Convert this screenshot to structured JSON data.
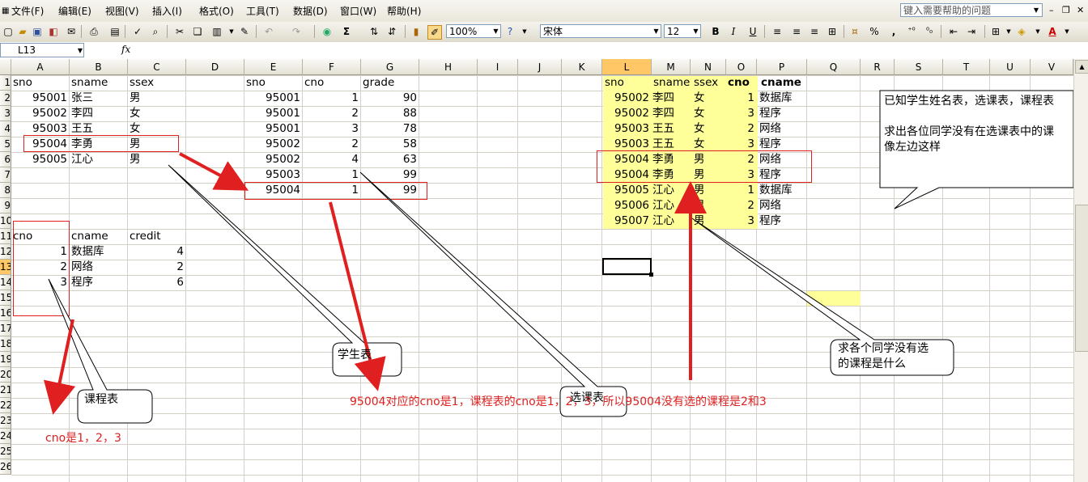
{
  "menu": [
    "文件(F)",
    "编辑(E)",
    "视图(V)",
    "插入(I)",
    "格式(O)",
    "工具(T)",
    "数据(D)",
    "窗口(W)",
    "帮助(H)"
  ],
  "help_placeholder": "键入需要帮助的问题",
  "toolbar": {
    "zoom": "100%",
    "font": "宋体",
    "size": "12",
    "bold": "B",
    "italic": "I",
    "underline": "U",
    "sigma": "Σ",
    "percent": "%",
    "comma": ","
  },
  "namebox": "L13",
  "fx": "fx",
  "columns": [
    "A",
    "B",
    "C",
    "D",
    "E",
    "F",
    "G",
    "H",
    "I",
    "J",
    "K",
    "L",
    "M",
    "N",
    "O",
    "P",
    "Q",
    "R",
    "S",
    "T",
    "U",
    "V"
  ],
  "rows": [
    "1",
    "2",
    "3",
    "4",
    "5",
    "6",
    "7",
    "8",
    "9",
    "10",
    "11",
    "12",
    "13",
    "14",
    "15",
    "16",
    "17",
    "18",
    "19",
    "20",
    "21",
    "22",
    "23",
    "24",
    "25",
    "26"
  ],
  "active_cell": {
    "column": "L",
    "row": "13"
  },
  "student_table": {
    "headers": [
      "sno",
      "sname",
      "ssex"
    ],
    "rows": [
      [
        "95001",
        "张三",
        "男"
      ],
      [
        "95002",
        "李四",
        "女"
      ],
      [
        "95003",
        "王五",
        "女"
      ],
      [
        "95004",
        "李勇",
        "男"
      ],
      [
        "95005",
        "江心",
        "男"
      ]
    ]
  },
  "sc_table": {
    "headers": [
      "sno",
      "cno",
      "grade"
    ],
    "rows": [
      [
        "95001",
        "1",
        "90"
      ],
      [
        "95001",
        "2",
        "88"
      ],
      [
        "95001",
        "3",
        "78"
      ],
      [
        "95002",
        "2",
        "58"
      ],
      [
        "95002",
        "4",
        "63"
      ],
      [
        "95003",
        "1",
        "99"
      ],
      [
        "95004",
        "1",
        "99"
      ]
    ]
  },
  "course_table": {
    "headers": [
      "cno",
      "cname",
      "credit"
    ],
    "rows": [
      [
        "1",
        "数据库",
        "4"
      ],
      [
        "2",
        "网络",
        "2"
      ],
      [
        "3",
        "程序",
        "6"
      ]
    ]
  },
  "result_table": {
    "headers": [
      "sno",
      "sname",
      "ssex",
      "cno",
      "cname"
    ],
    "rows": [
      [
        "95002",
        "李四",
        "女",
        "1",
        "数据库"
      ],
      [
        "95002",
        "李四",
        "女",
        "3",
        "程序"
      ],
      [
        "95003",
        "王五",
        "女",
        "2",
        "网络"
      ],
      [
        "95003",
        "王五",
        "女",
        "3",
        "程序"
      ],
      [
        "95004",
        "李勇",
        "男",
        "2",
        "网络"
      ],
      [
        "95004",
        "李勇",
        "男",
        "3",
        "程序"
      ],
      [
        "95005",
        "江心",
        "男",
        "1",
        "数据库"
      ],
      [
        "95006",
        "江心",
        "男",
        "2",
        "网络"
      ],
      [
        "95007",
        "江心",
        "男",
        "3",
        "程序"
      ]
    ]
  },
  "callouts": {
    "question_line1": "已知学生姓名表，选课表，课程表",
    "question_line2": "求出各位同学没有在选课表中的课",
    "question_line3": "像左边这样",
    "result_label_line1": "求各个同学没有选",
    "result_label_line2": "的课程是什么",
    "course_label": "课程表",
    "student_label": "学生表",
    "sc_label": "选课表"
  },
  "annotations": {
    "cno_note": "cno是1，2，3",
    "explain": "95004对应的cno是1，课程表的cno是1，2，3，所以95004没有选的课程是2和3"
  },
  "colors": {
    "highlight": "#ffff99",
    "annotation": "#e02020",
    "active_header": "#ffc766"
  }
}
